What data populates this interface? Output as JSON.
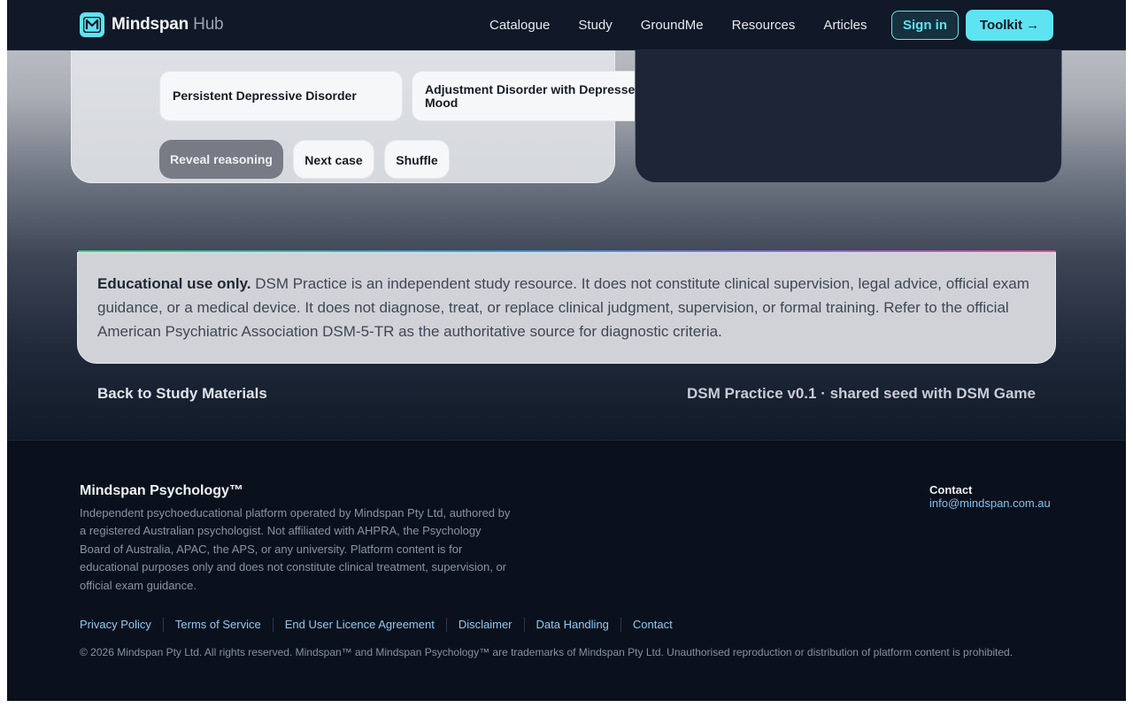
{
  "nav": {
    "brand_main": "Mindspan",
    "brand_sub": "Hub",
    "links": [
      "Catalogue",
      "Study",
      "GroundMe",
      "Resources",
      "Articles"
    ],
    "signin_label": "Sign in",
    "toolkit_label": "Toolkit →"
  },
  "quiz": {
    "options": [
      "Persistent Depressive Disorder",
      "Adjustment Disorder with Depressed Mood"
    ],
    "reveal_label": "Reveal reasoning",
    "next_label": "Next case",
    "shuffle_label": "Shuffle"
  },
  "disclaimer": {
    "lead": "Educational use only.",
    "text": " DSM Practice is an independent study resource. It does not constitute clinical supervision, legal advice, official exam guidance, or a medical device. It does not diagnose, treat, or replace clinical judgment, supervision, or formal training. Refer to the official American Psychiatric Association DSM-5-TR as the authoritative source for diagnostic criteria."
  },
  "page_footer": {
    "back_label": "Back to Study Materials",
    "version_label": "DSM Practice v0.1 · shared seed with DSM Game"
  },
  "footer": {
    "title": "Mindspan Psychology™",
    "description": "Independent psychoeducational platform operated by Mindspan Pty Ltd, authored by a registered Australian psychologist. Not affiliated with AHPRA, the Psychology Board of Australia, APAC, the APS, or any university. Platform content is for educational purposes only and does not constitute clinical treatment, supervision, or official exam guidance.",
    "contact_heading": "Contact",
    "contact_email": "info@mindspan.com.au",
    "links": [
      "Privacy Policy",
      "Terms of Service",
      "End User Licence Agreement",
      "Disclaimer",
      "Data Handling",
      "Contact"
    ],
    "copyright": "© 2026 Mindspan Pty Ltd. All rights reserved. Mindspan™ and Mindspan Psychology™ are trademarks of Mindspan Pty Ltd. Unauthorised reproduction or distribution of platform content is prohibited."
  },
  "colors": {
    "accent": "#5ee3f2",
    "nav_bg": "#111827",
    "footer_bg": "#0b111c"
  }
}
